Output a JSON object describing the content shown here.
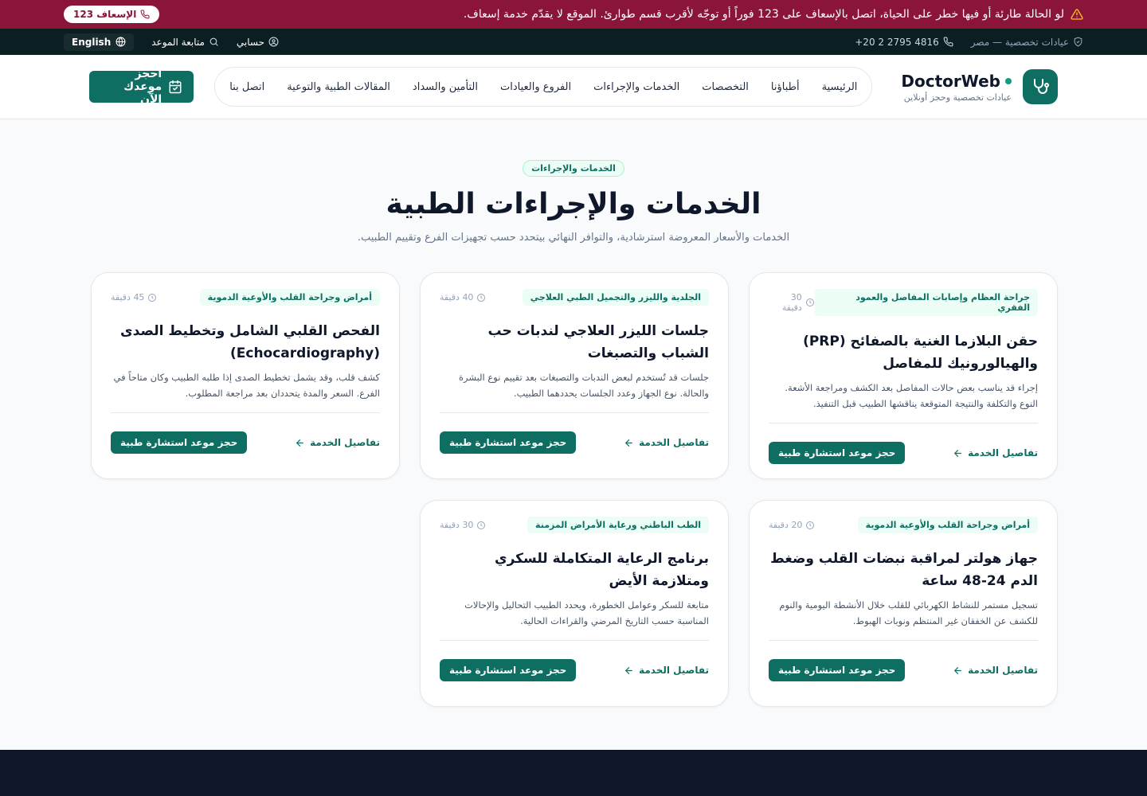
{
  "alert": {
    "message": "لو الحالة طارئة أو فيها خطر على الحياة، اتصل بالإسعاف على 123 فوراً أو توجّه لأقرب قسم طوارئ. الموقع لا يقدّم خدمة إسعاف.",
    "button": "الإسعاف 123"
  },
  "topbar": {
    "tagline": "عيادات تخصصية — مصر",
    "phone": "+20 2 2795 4816",
    "account": "حسابي",
    "track": "متابعة الموعد",
    "language": "English"
  },
  "header": {
    "brand_name": "DoctorWeb",
    "brand_sub": "عيادات تخصصية وحجز أونلاين",
    "nav": [
      "الرئيسية",
      "أطباؤنا",
      "التخصصات",
      "الخدمات والإجراءات",
      "الفروع والعيادات",
      "التأمين والسداد",
      "المقالات الطبية والتوعية",
      "اتصل بنا"
    ],
    "book_button": "احجز موعدك الآن"
  },
  "hero": {
    "chip": "الخدمات والإجراءات",
    "title": "الخدمات والإجراءات الطبية",
    "subtitle": "الخدمات والأسعار المعروضة استرشادية، والتوافر النهائي بيتحدد حسب تجهيزات الفرع وتقييم الطبيب."
  },
  "services": [
    {
      "tag": "جراحة العظام وإصابات المفاصل والعمود الفقري",
      "duration": "30 دقيقة",
      "title": "حقن البلازما الغنية بالصفائح (PRP) والهيالورونيك للمفاصل",
      "description": "إجراء قد يناسب بعض حالات المفاصل بعد الكشف ومراجعة الأشعة. النوع والتكلفة والنتيجة المتوقعة يناقشها الطبيب قبل التنفيذ.",
      "details": "تفاصيل الخدمة",
      "cta": "حجز موعد استشارة طبية"
    },
    {
      "tag": "الجلدية والليزر والتجميل الطبي العلاجي",
      "duration": "40 دقيقة",
      "title": "جلسات الليزر العلاجي لندبات حب الشباب والتصبغات",
      "description": "جلسات قد تُستخدم لبعض الندبات والتصبغات بعد تقييم نوع البشرة والحالة. نوع الجهاز وعدد الجلسات يحددهما الطبيب.",
      "details": "تفاصيل الخدمة",
      "cta": "حجز موعد استشارة طبية"
    },
    {
      "tag": "أمراض وجراحة القلب والأوعية الدموية",
      "duration": "45 دقيقة",
      "title": "الفحص القلبي الشامل وتخطيط الصدى (Echocardiography)",
      "description": "كشف قلب، وقد يشمل تخطيط الصدى إذا طلبه الطبيب وكان متاحاً في الفرع. السعر والمدة يتحددان بعد مراجعة المطلوب.",
      "details": "تفاصيل الخدمة",
      "cta": "حجز موعد استشارة طبية"
    },
    {
      "tag": "أمراض وجراحة القلب والأوعية الدموية",
      "duration": "20 دقيقة",
      "title": "جهاز هولتر لمراقبة نبضات القلب وضغط الدم 24-48 ساعة",
      "description": "تسجيل مستمر للنشاط الكهربائي للقلب خلال الأنشطة اليومية والنوم للكشف عن الخفقان غير المنتظم ونوبات الهبوط.",
      "details": "تفاصيل الخدمة",
      "cta": "حجز موعد استشارة طبية"
    },
    {
      "tag": "الطب الباطني ورعاية الأمراض المزمنة",
      "duration": "30 دقيقة",
      "title": "برنامج الرعاية المتكاملة للسكري ومتلازمة الأيض",
      "description": "متابعة للسكر وعوامل الخطورة، ويحدد الطبيب التحاليل والإحالات المناسبة حسب التاريخ المرضي والقراءات الحالية.",
      "details": "تفاصيل الخدمة",
      "cta": "حجز موعد استشارة طبية"
    }
  ],
  "colors": {
    "brand": "#0f6e62",
    "alert": "#8b1538",
    "dark": "#0b1f22",
    "footer": "#0f172a"
  }
}
